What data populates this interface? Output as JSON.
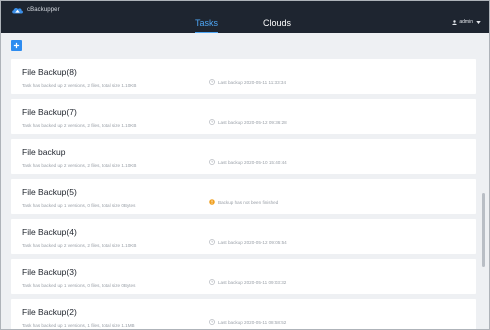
{
  "app": {
    "name": "cBackupper"
  },
  "nav": {
    "tasks_label": "Tasks",
    "clouds_label": "Clouds"
  },
  "user": {
    "name": "admin"
  },
  "colors": {
    "topbar": "#1e2530",
    "accent": "#2d8cf0",
    "warning": "#f0a020"
  },
  "tasks": [
    {
      "title": "File Backup(8)",
      "subtitle": "Task has backed up 2 versions, 2 files, total size 1.10KB",
      "status": "Last backup 2020-05-11 11:33:34",
      "status_icon": "clock-icon"
    },
    {
      "title": "File Backup(7)",
      "subtitle": "Task has backed up 2 versions, 2 files, total size 1.10KB",
      "status": "Last backup 2020-05-12 09:36:28",
      "status_icon": "clock-icon"
    },
    {
      "title": "File backup",
      "subtitle": "Task has backed up 2 versions, 2 files, total size 1.10KB",
      "status": "Last backup 2020-05-10 15:40:44",
      "status_icon": "clock-icon"
    },
    {
      "title": "File Backup(5)",
      "subtitle": "Task has backed up 1 versions, 0 files, total size 0Bytes",
      "status": "Backup has not been finished",
      "status_icon": "warning-icon"
    },
    {
      "title": "File Backup(4)",
      "subtitle": "Task has backed up 2 versions, 2 files, total size 1.10KB",
      "status": "Last backup 2020-05-12 09:05:54",
      "status_icon": "clock-icon"
    },
    {
      "title": "File Backup(3)",
      "subtitle": "Task has backed up 1 versions, 0 files, total size 0Bytes",
      "status": "Last backup 2020-05-11 09:03:32",
      "status_icon": "clock-icon"
    },
    {
      "title": "File Backup(2)",
      "subtitle": "Task has backed up 1 versions, 1 files, total size 1.1MB",
      "status": "Last backup 2020-05-11 08:58:52",
      "status_icon": "clock-icon"
    }
  ]
}
